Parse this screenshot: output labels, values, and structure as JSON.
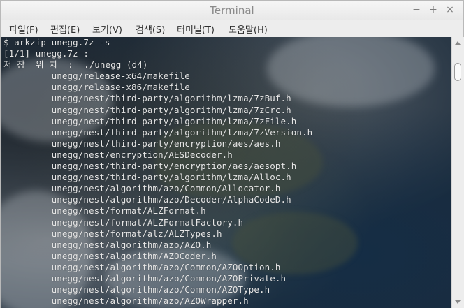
{
  "window": {
    "title": "Terminal",
    "controls": {
      "minimize": "−",
      "maximize": "+",
      "close": "×"
    }
  },
  "menubar": {
    "items": [
      {
        "label": "파일(F)"
      },
      {
        "label": "편집(E)"
      },
      {
        "label": "보기(V)"
      },
      {
        "label": "검색(S)"
      },
      {
        "label": "터미널(T)"
      },
      {
        "label": "도움말(H)"
      }
    ]
  },
  "terminal": {
    "lines": [
      "$ arkzip unegg.7z -s",
      "[1/1] unegg.7z :",
      "저 장  위 치  :  ./unegg (d4)",
      "         unegg/release-x64/makefile",
      "         unegg/release-x86/makefile",
      "         unegg/nest/third-party/algorithm/lzma/7zBuf.h",
      "         unegg/nest/third-party/algorithm/lzma/7zCrc.h",
      "         unegg/nest/third-party/algorithm/lzma/7zFile.h",
      "         unegg/nest/third-party/algorithm/lzma/7zVersion.h",
      "         unegg/nest/third-party/encryption/aes/aes.h",
      "         unegg/nest/encryption/AESDecoder.h",
      "         unegg/nest/third-party/encryption/aes/aesopt.h",
      "         unegg/nest/third-party/algorithm/lzma/Alloc.h",
      "         unegg/nest/algorithm/azo/Common/Allocator.h",
      "         unegg/nest/algorithm/azo/Decoder/AlphaCodeD.h",
      "         unegg/nest/format/ALZFormat.h",
      "         unegg/nest/format/ALZFormatFactory.h",
      "         unegg/nest/format/alz/ALZTypes.h",
      "         unegg/nest/algorithm/azo/AZO.h",
      "         unegg/nest/algorithm/AZOCoder.h",
      "         unegg/nest/algorithm/azo/Common/AZOOption.h",
      "         unegg/nest/algorithm/azo/Common/AZOPrivate.h",
      "         unegg/nest/algorithm/azo/Common/AZOType.h",
      "         unegg/nest/algorithm/azo/AZOWrapper.h"
    ]
  }
}
